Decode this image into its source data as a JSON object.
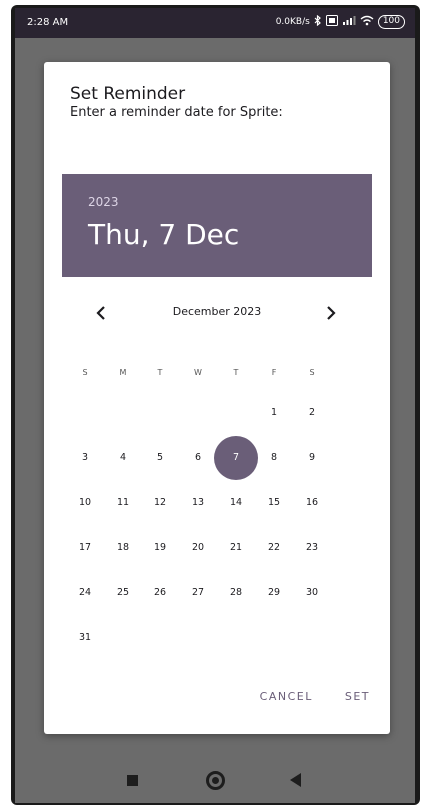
{
  "status_bar": {
    "time": "2:28 AM",
    "network_speed": "0.0KB/s",
    "icons": [
      "bluetooth-icon",
      "volte-icon",
      "signal-icon",
      "wifi-icon"
    ],
    "battery": "100"
  },
  "dialog": {
    "title": "Set Reminder",
    "subtitle": "Enter a reminder date for Sprite:",
    "header": {
      "year": "2023",
      "selected_date": "Thu, 7 Dec"
    },
    "calendar": {
      "month_label": "December 2023",
      "prev_icon": "chevron-left-icon",
      "next_icon": "chevron-right-icon",
      "weekdays": [
        "S",
        "M",
        "T",
        "W",
        "T",
        "F",
        "S"
      ],
      "weeks": [
        [
          "",
          "",
          "",
          "",
          "",
          "1",
          "2"
        ],
        [
          "3",
          "4",
          "5",
          "6",
          "7",
          "8",
          "9"
        ],
        [
          "10",
          "11",
          "12",
          "13",
          "14",
          "15",
          "16"
        ],
        [
          "17",
          "18",
          "19",
          "20",
          "21",
          "22",
          "23"
        ],
        [
          "24",
          "25",
          "26",
          "27",
          "28",
          "29",
          "30"
        ],
        [
          "31",
          "",
          "",
          "",
          "",
          "",
          ""
        ]
      ],
      "selected_day": "7"
    },
    "actions": {
      "cancel_label": "CANCEL",
      "set_label": "SET"
    }
  },
  "nav_bar": {
    "icons": [
      "recents-square-icon",
      "home-circle-icon",
      "back-triangle-icon"
    ]
  },
  "colors": {
    "accent": "#6a5e78",
    "status_bar": "#2a2431",
    "scrim": "#6b6b6b"
  }
}
